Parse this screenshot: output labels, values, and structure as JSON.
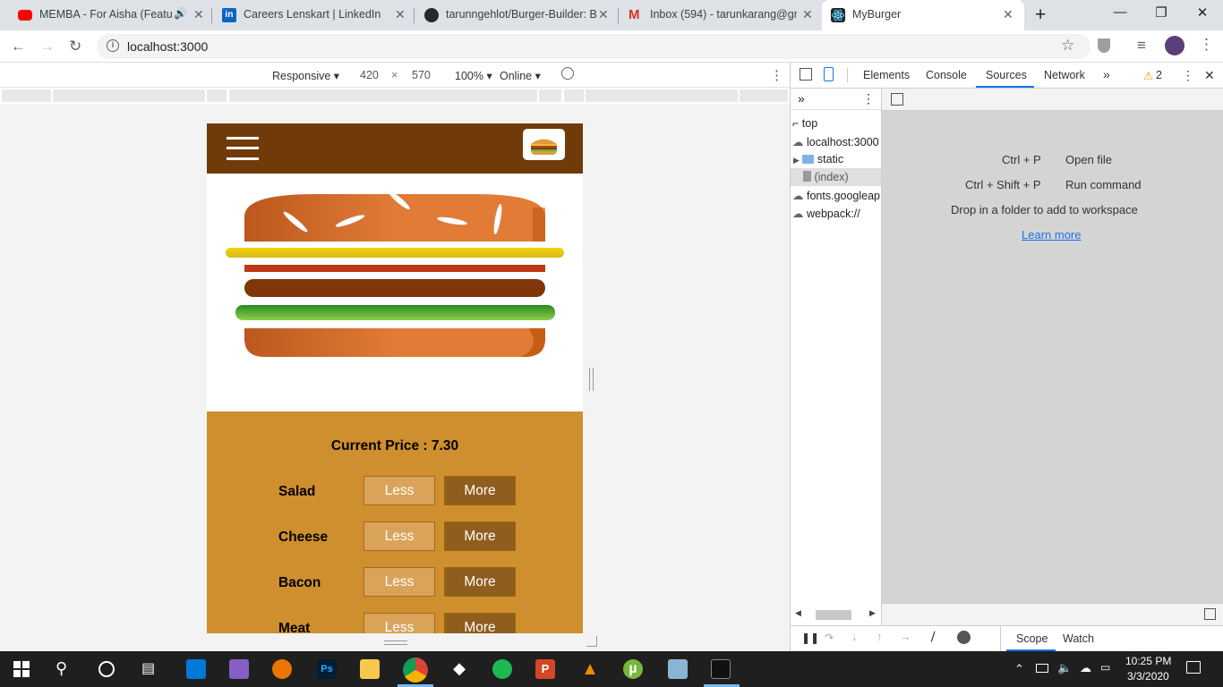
{
  "browser": {
    "tabs": [
      {
        "title": "MEMBA - For Aisha (Featu",
        "favicon_color": "#ff0000"
      },
      {
        "title": "Careers Lenskart | LinkedIn",
        "favicon_color": "#0a66c2"
      },
      {
        "title": "tarunngehlot/Burger-Builder: B",
        "favicon_color": "#24292e"
      },
      {
        "title": "Inbox (594) - tarunkarang@gm",
        "favicon_color": "#d93025"
      },
      {
        "title": "MyBurger",
        "favicon_color": "#20232a"
      }
    ],
    "new_tab": "+",
    "close_glyph": "✕",
    "window_controls": [
      "—",
      "❐",
      "✕"
    ],
    "url": "localhost:3000"
  },
  "device_toolbar": {
    "device": "Responsive",
    "width": "420",
    "times": "×",
    "height": "570",
    "zoom": "100%",
    "network": "Online"
  },
  "app": {
    "price_label": "Current Price : 7.30",
    "controls": [
      {
        "label": "Salad",
        "less": "Less",
        "more": "More"
      },
      {
        "label": "Cheese",
        "less": "Less",
        "more": "More"
      },
      {
        "label": "Bacon",
        "less": "Less",
        "more": "More"
      },
      {
        "label": "Meat",
        "less": "Less",
        "more": "More"
      }
    ],
    "colors": {
      "toolbar": "#703b09",
      "controls_bg": "#cf8f2e",
      "more_button": "#8f5e1e",
      "less_button": "#daa35a"
    }
  },
  "devtools": {
    "tabs": [
      "Elements",
      "Console",
      "Sources",
      "Network",
      "»"
    ],
    "active_tab": "Sources",
    "warnings": "2",
    "tree": [
      "top",
      "localhost:3000",
      "static",
      "(index)",
      "fonts.googleap",
      "webpack://"
    ],
    "shortcuts": [
      {
        "keys": "Ctrl + P",
        "action": "Open file"
      },
      {
        "keys": "Ctrl + Shift + P",
        "action": "Run command"
      }
    ],
    "drop_hint": "Drop in a folder to add to workspace",
    "learn_more": "Learn more",
    "bottom_tabs": [
      "Scope",
      "Watch"
    ]
  },
  "taskbar": {
    "time": "10:25 PM",
    "date": "3/3/2020"
  }
}
